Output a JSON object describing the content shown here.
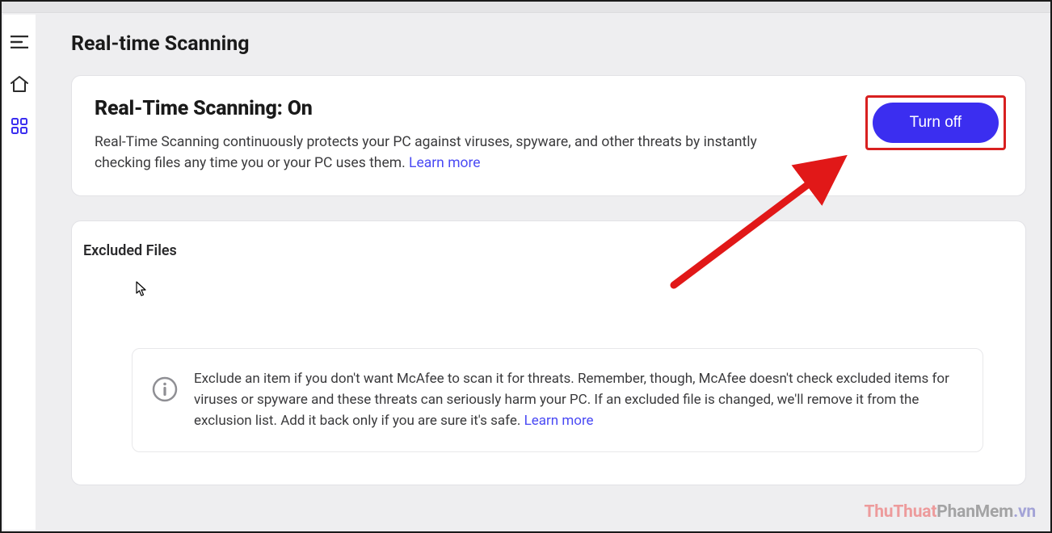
{
  "page": {
    "title": "Real-time Scanning"
  },
  "status_card": {
    "heading": "Real-Time Scanning: On",
    "description": "Real-Time Scanning continuously protects your PC against viruses, spyware, and other threats by instantly checking files any time you or your PC uses them. ",
    "learn_more": "Learn more",
    "button_label": "Turn off"
  },
  "excluded": {
    "title": "Excluded Files",
    "info_text": "Exclude an item if you don't want McAfee to scan it for threats. Remember, though, McAfee doesn't check excluded items for viruses or spyware and these threats can seriously harm your PC. If an excluded file is changed, we'll remove it from the exclusion list. Add it back only if you are sure it's safe. ",
    "learn_more": "Learn more"
  },
  "watermark": {
    "part1": "ThuThuat",
    "part2": "PhanMem",
    "part3": ".vn"
  },
  "colors": {
    "accent": "#3b2ef0",
    "highlight_border": "#d82020",
    "link": "#4a4af4"
  }
}
